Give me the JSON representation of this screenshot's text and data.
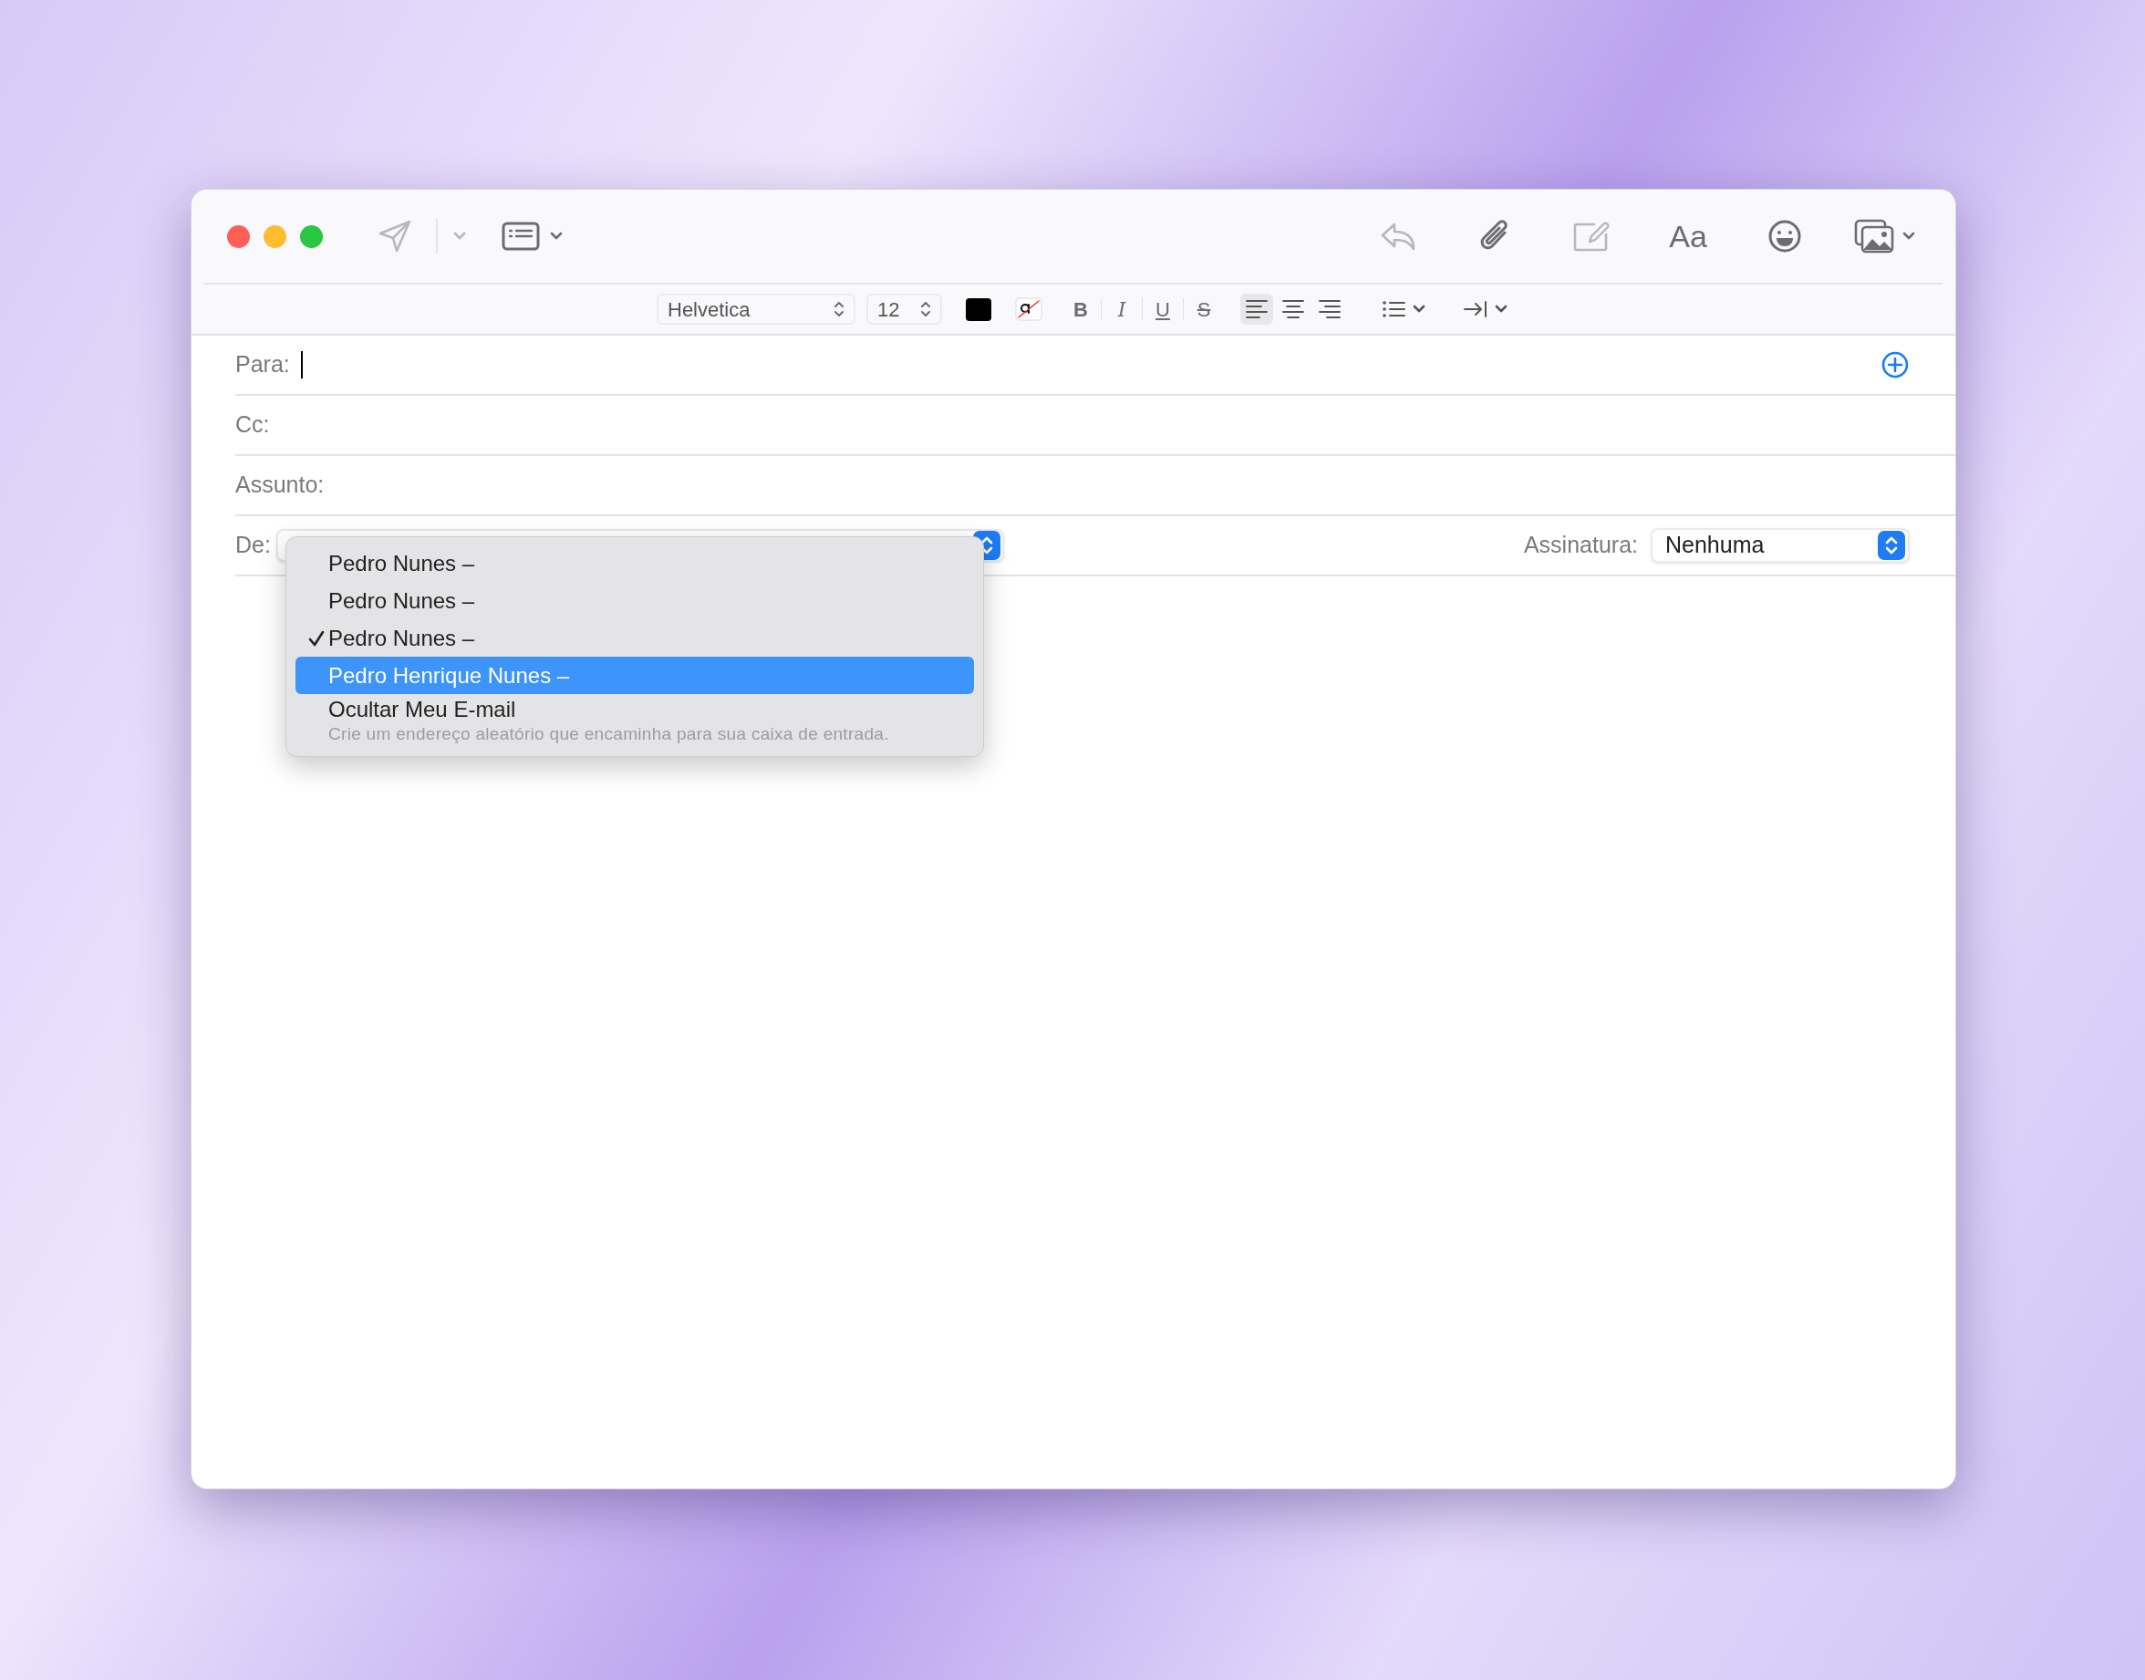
{
  "window": {
    "traffic_lights": [
      {
        "color": "#ff5f57"
      },
      {
        "color": "#febc2e"
      },
      {
        "color": "#28c840"
      }
    ]
  },
  "toolbar": {
    "left": [
      {
        "kind": "send",
        "disabled": true,
        "menu": true
      },
      {
        "kind": "header-fields",
        "disabled": false,
        "menu": true
      }
    ],
    "right": [
      {
        "kind": "reply",
        "disabled": true,
        "menu": false
      },
      {
        "kind": "attach",
        "disabled": false,
        "menu": false
      },
      {
        "kind": "markup",
        "disabled": true,
        "menu": false
      },
      {
        "kind": "text",
        "label": "Aa",
        "disabled": false,
        "menu": false
      },
      {
        "kind": "emoji",
        "disabled": false,
        "menu": false
      },
      {
        "kind": "photo",
        "disabled": false,
        "menu": true
      }
    ]
  },
  "format_bar": {
    "font": "Helvetica",
    "size": "12",
    "styles": [
      {
        "kind": "bold",
        "label": "B"
      },
      {
        "kind": "italic",
        "label": "I"
      },
      {
        "kind": "underline",
        "label": "U"
      },
      {
        "kind": "strike",
        "label": "S"
      }
    ],
    "alignment": [
      {
        "kind": "left",
        "selected": true
      },
      {
        "kind": "center",
        "selected": false
      },
      {
        "kind": "right",
        "selected": false
      }
    ]
  },
  "fields": [
    {
      "label": "Para:",
      "focused": true,
      "add_button": true
    },
    {
      "label": "Cc:",
      "focused": false,
      "add_button": false
    },
    {
      "label": "Assunto:",
      "focused": false,
      "add_button": false
    }
  ],
  "from": {
    "label": "De:",
    "menu": {
      "items": [
        {
          "label": "Pedro Nunes –",
          "checked": false,
          "selected": false
        },
        {
          "label": "Pedro Nunes –",
          "checked": false,
          "selected": false
        },
        {
          "label": "Pedro Nunes –",
          "checked": true,
          "selected": false
        },
        {
          "label": "Pedro Henrique Nunes –",
          "checked": false,
          "selected": true
        }
      ],
      "hide_item": {
        "label": "Ocultar Meu E-mail",
        "description": "Crie um endereço aleatório que encaminha para sua caixa de entrada."
      }
    }
  },
  "signature": {
    "label": "Assinatura:",
    "value": "Nenhuma"
  }
}
